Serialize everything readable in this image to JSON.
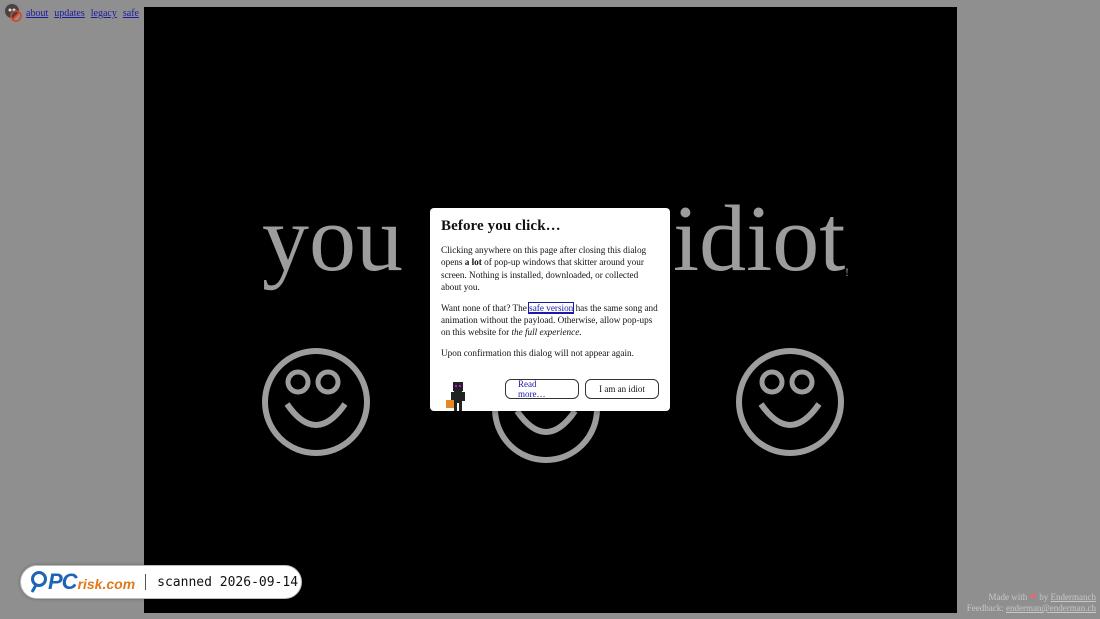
{
  "nav": {
    "links": [
      "about",
      "updates",
      "legacy",
      "safe"
    ]
  },
  "stage": {
    "word_left": "you",
    "word_right": "idiot",
    "exclaim": "!"
  },
  "dialog": {
    "title": "Before you click…",
    "p1_a": "Clicking anywhere on this page after closing this dialog opens ",
    "p1_bold": "a lot",
    "p1_b": " of pop-up windows that skitter around your screen. Nothing is installed, downloaded, or collected about you.",
    "p2_a": "Want none of that? The ",
    "p2_link": "safe version",
    "p2_b": " has the same song and animation without the payload. Otherwise, allow pop-ups on this website for ",
    "p2_italic": "the full experience",
    "p2_c": ".",
    "p3": "Upon confirmation this dialog will not appear again.",
    "read_more": "Read more…",
    "confirm": "I am an idiot"
  },
  "badge": {
    "logo_pc": "PC",
    "logo_risk": "risk.com",
    "scanned": "scanned 2026-09-14"
  },
  "footer": {
    "made_with": "Made with",
    "by": "by",
    "author": "Endermanch",
    "feedback_label": "Feedback:",
    "email": "enderman@enderman.ch"
  },
  "colors": {
    "page_bg": "#8f8f8f",
    "stage_bg": "#000000",
    "text_gray": "#9d9d9d",
    "link": "#1a1aa6"
  }
}
